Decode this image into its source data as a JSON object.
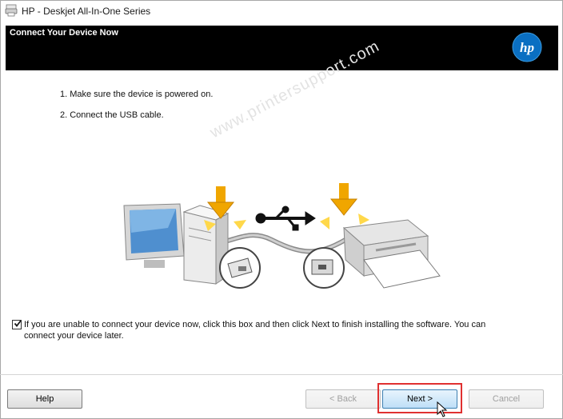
{
  "window": {
    "title": "HP - Deskjet All-In-One Series",
    "icon": "hp-printer-app-icon"
  },
  "banner": {
    "title": "Connect Your Device Now",
    "logo": "hp-logo",
    "background_color": "#000000"
  },
  "steps": [
    "1. Make sure the device is powered on.",
    "2. Connect the USB cable."
  ],
  "illustration": {
    "elements": [
      "computer-icon",
      "usb-symbol-icon",
      "printer-icon",
      "down-arrow-icon",
      "usb-plug-icon"
    ],
    "watermark": "www.printersupport.com"
  },
  "option": {
    "checked": true,
    "label": "If you are unable to connect your device now, click this box and then click Next to finish installing the software. You can connect your device later."
  },
  "buttons": {
    "help": "Help",
    "back": "< Back",
    "next": "Next >",
    "cancel": "Cancel"
  },
  "colors": {
    "arrow": "#f0a600",
    "highlight": "#e03030",
    "next_button": "#bedff7"
  }
}
